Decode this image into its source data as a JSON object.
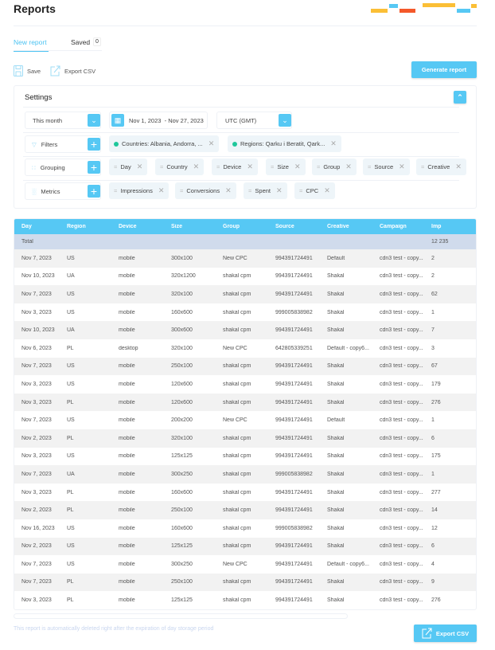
{
  "header": {
    "title": "Reports"
  },
  "brand_colors": {
    "yellow": "#fbbf36",
    "blue": "#56c8f4",
    "red": "#f4582a"
  },
  "tabs": {
    "new_report": "New report",
    "saved": "Saved",
    "saved_count": "0"
  },
  "toolbar": {
    "save": "Save",
    "export_csv": "Export CSV",
    "generate": "Generate report"
  },
  "settings": {
    "title": "Settings",
    "period": "This month",
    "date_range": "Nov 1, 2023  - Nov 27, 2023",
    "timezone": "UTC (GMT)",
    "filters_label": "Filters",
    "filters": [
      "Countries: Albania, Andorra, ...",
      "Regions: Qarku i Beratit, Qark..."
    ],
    "grouping_label": "Grouping",
    "grouping": [
      "Day",
      "Country",
      "Device",
      "Size",
      "Group",
      "Source",
      "Creative"
    ],
    "metrics_label": "Metrics",
    "metrics": [
      "Impressions",
      "Conversions",
      "Spent",
      "CPC"
    ]
  },
  "table": {
    "columns": [
      "Day",
      "Region",
      "Device",
      "Size",
      "Group",
      "Source",
      "Creative",
      "Campaign",
      "Imp"
    ],
    "total": {
      "label": "Total",
      "imp": "12 235"
    },
    "rows": [
      [
        "Nov 7, 2023",
        "US",
        "mobile",
        "300x100",
        "New CPC",
        "994391724491",
        "Default",
        "cdn3 test - copy...",
        "2"
      ],
      [
        "Nov 10, 2023",
        "UA",
        "mobile",
        "320x1200",
        "shakal cpm",
        "994391724491",
        "Shakal",
        "cdn3 test - copy...",
        "2"
      ],
      [
        "Nov 7, 2023",
        "US",
        "mobile",
        "320x100",
        "shakal cpm",
        "994391724491",
        "Shakal",
        "cdn3 test - copy...",
        "62"
      ],
      [
        "Nov 3, 2023",
        "US",
        "mobile",
        "160x600",
        "shakal cpm",
        "999005838982",
        "Shakal",
        "cdn3 test - copy...",
        "1"
      ],
      [
        "Nov 10, 2023",
        "UA",
        "mobile",
        "300x600",
        "shakal cpm",
        "994391724491",
        "Shakal",
        "cdn3 test - copy...",
        "7"
      ],
      [
        "Nov 6, 2023",
        "PL",
        "desktop",
        "320x100",
        "New CPC",
        "642805339251",
        "Default - copy6...",
        "cdn3 test - copy...",
        "3"
      ],
      [
        "Nov 7, 2023",
        "US",
        "mobile",
        "250x100",
        "shakal cpm",
        "994391724491",
        "Shakal",
        "cdn3 test - copy...",
        "67"
      ],
      [
        "Nov 3, 2023",
        "US",
        "mobile",
        "120x600",
        "shakal cpm",
        "994391724491",
        "Shakal",
        "cdn3 test - copy...",
        "179"
      ],
      [
        "Nov 3, 2023",
        "PL",
        "mobile",
        "120x600",
        "shakal cpm",
        "994391724491",
        "Shakal",
        "cdn3 test - copy...",
        "276"
      ],
      [
        "Nov 7, 2023",
        "US",
        "mobile",
        "200x200",
        "New CPC",
        "994391724491",
        "Default",
        "cdn3 test - copy...",
        "1"
      ],
      [
        "Nov 2, 2023",
        "PL",
        "mobile",
        "320x100",
        "shakal cpm",
        "994391724491",
        "Shakal",
        "cdn3 test - copy...",
        "6"
      ],
      [
        "Nov 3, 2023",
        "US",
        "mobile",
        "125x125",
        "shakal cpm",
        "994391724491",
        "Shakal",
        "cdn3 test - copy...",
        "175"
      ],
      [
        "Nov 7, 2023",
        "UA",
        "mobile",
        "300x250",
        "shakal cpm",
        "999005838982",
        "Shakal",
        "cdn3 test - copy...",
        "1"
      ],
      [
        "Nov 3, 2023",
        "PL",
        "mobile",
        "160x600",
        "shakal cpm",
        "994391724491",
        "Shakal",
        "cdn3 test - copy...",
        "277"
      ],
      [
        "Nov 2, 2023",
        "PL",
        "mobile",
        "250x100",
        "shakal cpm",
        "994391724491",
        "Shakal",
        "cdn3 test - copy...",
        "14"
      ],
      [
        "Nov 16, 2023",
        "US",
        "mobile",
        "160x600",
        "shakal cpm",
        "999005838982",
        "Shakal",
        "cdn3 test - copy...",
        "12"
      ],
      [
        "Nov 2, 2023",
        "US",
        "mobile",
        "125x125",
        "shakal cpm",
        "994391724491",
        "Shakal",
        "cdn3 test - copy...",
        "6"
      ],
      [
        "Nov 7, 2023",
        "US",
        "mobile",
        "300x250",
        "New CPC",
        "994391724491",
        "Default - copy6...",
        "cdn3 test - copy...",
        "4"
      ],
      [
        "Nov 7, 2023",
        "PL",
        "mobile",
        "250x100",
        "shakal cpm",
        "994391724491",
        "Shakal",
        "cdn3 test - copy...",
        "9"
      ],
      [
        "Nov 3, 2023",
        "PL",
        "mobile",
        "125x125",
        "shakal cpm",
        "994391724491",
        "Shakal",
        "cdn3 test - copy...",
        "276"
      ]
    ]
  },
  "footer": {
    "note": "This report is automatically deleted right after the expiration of day storage period",
    "export_csv": "Export CSV"
  }
}
